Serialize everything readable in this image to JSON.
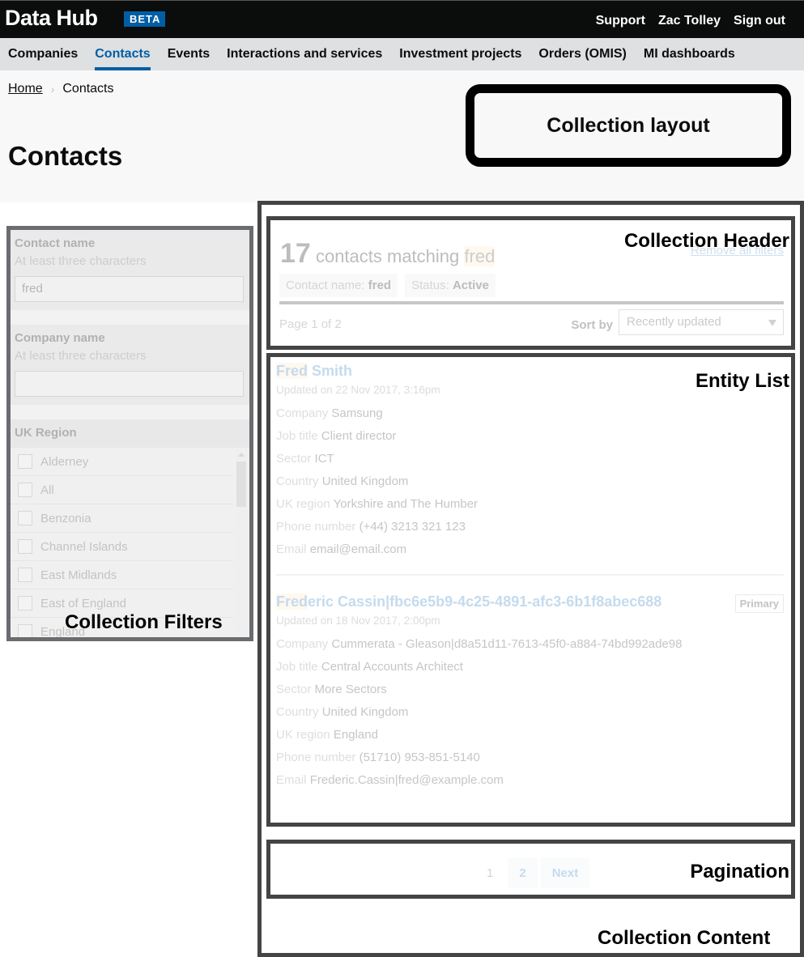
{
  "header": {
    "brand": "Data Hub",
    "badge": "BETA",
    "links": [
      "Support",
      "Zac Tolley",
      "Sign out"
    ]
  },
  "nav": {
    "items": [
      "Companies",
      "Contacts",
      "Events",
      "Interactions and services",
      "Investment projects",
      "Orders (OMIS)",
      "MI dashboards"
    ],
    "active": "Contacts"
  },
  "breadcrumb": {
    "home": "Home",
    "separator": "›",
    "current": "Contacts"
  },
  "page_title": "Contacts",
  "annotations": {
    "collection_layout": "Collection layout",
    "collection_header": "Collection Header",
    "entity_list": "Entity List",
    "collection_filters": "Collection Filters",
    "pagination": "Pagination",
    "collection_content": "Collection Content"
  },
  "filters": {
    "contact_name": {
      "label": "Contact name",
      "hint": "At least three characters",
      "value": "fred"
    },
    "company_name": {
      "label": "Company name",
      "hint": "At least three characters",
      "value": ""
    },
    "uk_region": {
      "label": "UK Region",
      "options": [
        "Alderney",
        "All",
        "Benzonia",
        "Channel Islands",
        "East Midlands",
        "East of England",
        "England"
      ]
    }
  },
  "collection_header": {
    "count": "17",
    "count_text": "contacts matching",
    "term": "fred",
    "remove_all": "Remove all filters",
    "chips": [
      {
        "label": "Contact name:",
        "value": "fred"
      },
      {
        "label": "Status:",
        "value": "Active"
      }
    ],
    "page_summary": "Page 1 of 2",
    "sort_label": "Sort by",
    "sort_value": "Recently updated"
  },
  "entities": [
    {
      "name_hl": "Fred",
      "name_rest": " Smith",
      "updated": "Updated on 22 Nov 2017, 3:16pm",
      "badge": "",
      "meta": [
        {
          "k": "Company",
          "v": "Samsung"
        },
        {
          "k": "Job title",
          "v": "Client director"
        },
        {
          "k": "Sector",
          "v": "ICT"
        },
        {
          "k": "Country",
          "v": "United Kingdom"
        },
        {
          "k": "UK region",
          "v": "Yorkshire and The Humber"
        },
        {
          "k": "Phone number",
          "v": "(+44) 3213 321 123"
        },
        {
          "k": "Email",
          "v": "email@email.com"
        }
      ]
    },
    {
      "name_hl": "Fred",
      "name_rest": "eric Cassin|fbc6e5b9-4c25-4891-afc3-6b1f8abec688",
      "updated": "Updated on 18 Nov 2017, 2:00pm",
      "badge": "Primary",
      "meta": [
        {
          "k": "Company",
          "v": "Cummerata - Gleason|d8a51d11-7613-45f0-a884-74bd992ade98"
        },
        {
          "k": "Job title",
          "v": "Central Accounts Architect"
        },
        {
          "k": "Sector",
          "v": "More Sectors"
        },
        {
          "k": "Country",
          "v": "United Kingdom"
        },
        {
          "k": "UK region",
          "v": "England"
        },
        {
          "k": "Phone number",
          "v": "(51710) 953-851-5140"
        },
        {
          "k": "Email",
          "v": "Frederic.Cassin|fred@example.com"
        }
      ]
    }
  ],
  "pagination": {
    "pages": [
      "1",
      "2"
    ],
    "current": "1",
    "next": "Next"
  }
}
